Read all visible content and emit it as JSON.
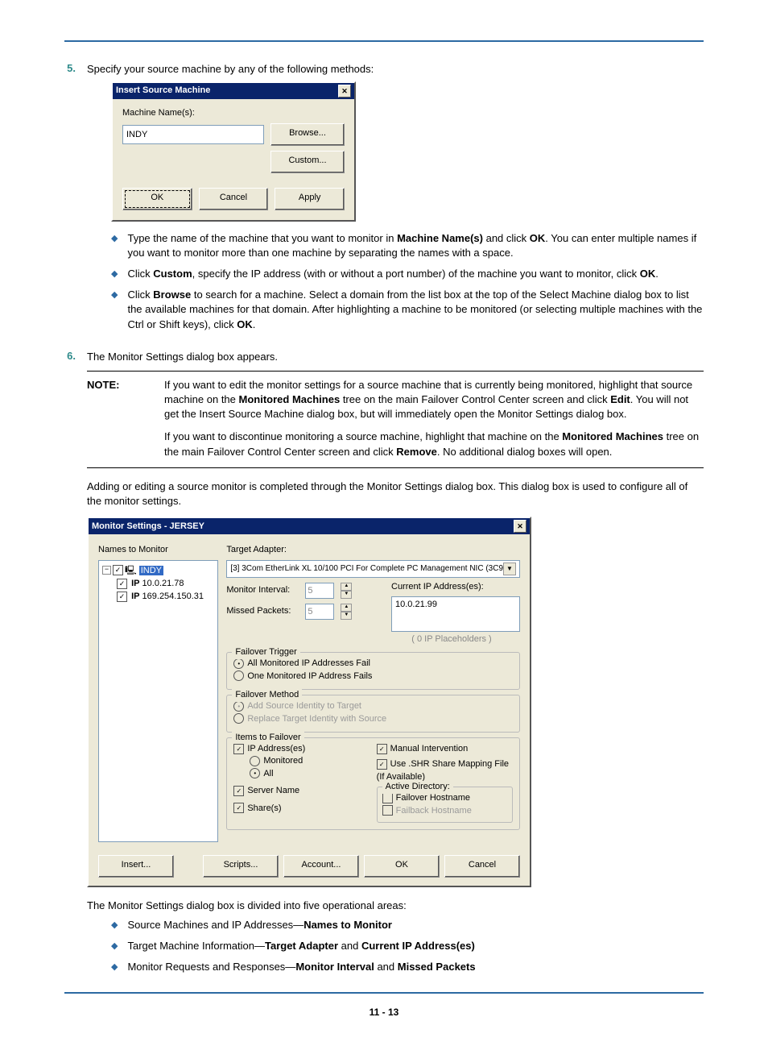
{
  "steps": {
    "5": {
      "num": "5.",
      "text": "Specify your source machine by any of the following methods:"
    },
    "6": {
      "num": "6.",
      "text": "The Monitor Settings dialog box appears."
    }
  },
  "dialog1": {
    "title": "Insert Source Machine",
    "label": "Machine Name(s):",
    "value": "INDY",
    "btn_browse": "Browse...",
    "btn_custom": "Custom...",
    "btn_ok": "OK",
    "btn_cancel": "Cancel",
    "btn_apply": "Apply"
  },
  "bullets1": {
    "a_pre": "Type the name of the machine that you want to monitor in ",
    "a_bold1": "Machine Name(s)",
    "a_mid": " and click ",
    "a_bold2": "OK",
    "a_post": ". You can enter multiple names if you want to monitor more than one machine by separating the names with a space.",
    "b_pre": "Click ",
    "b_bold1": "Custom",
    "b_mid": ", specify the IP address (with or without a port number) of the machine you want to monitor, click ",
    "b_bold2": "OK",
    "b_post": ".",
    "c_pre": "Click ",
    "c_bold1": "Browse",
    "c_mid": " to search for a machine. Select a domain from the list box at the top of the Select Machine dialog box to list the available machines for that domain.  After highlighting a machine to be monitored (or selecting multiple machines with the Ctrl or Shift keys), click ",
    "c_bold2": "OK",
    "c_post": "."
  },
  "note": {
    "label": "NOTE:",
    "p1_pre": "If you want to edit the monitor settings for a source machine that is currently being monitored, highlight that source machine on the ",
    "p1_bold1": "Monitored Machines",
    "p1_mid": " tree on the main Failover Control Center screen and click ",
    "p1_bold2": "Edit",
    "p1_post": ". You will not get the Insert Source Machine dialog box, but will immediately open the Monitor Settings dialog box.",
    "p2_pre": "If you want to discontinue monitoring a source machine, highlight that machine on the ",
    "p2_bold1": "Monitored Machines",
    "p2_mid": " tree on the main Failover Control Center screen and click ",
    "p2_bold2": "Remove",
    "p2_post": ". No additional dialog boxes will open."
  },
  "para_after_note": "Adding or editing a source monitor is completed through the Monitor Settings dialog box. This dialog box is used to configure all of the monitor settings.",
  "dialog2": {
    "title": "Monitor Settings - JERSEY",
    "names_label": "Names to Monitor",
    "tree_root": "INDY",
    "tree_ip1": "10.0.21.78",
    "tree_ip2": "169.254.150.31",
    "target_label": "Target Adapter:",
    "target_value": "[3] 3Com EtherLink XL 10/100 PCI For Complete PC Management NIC (3C9",
    "monitor_interval": "Monitor Interval:",
    "monitor_interval_val": "5",
    "missed_packets": "Missed Packets:",
    "missed_packets_val": "5",
    "current_ip_label": "Current IP Address(es):",
    "current_ip_val": "10.0.21.99",
    "placeholder_btn": "( 0 IP Placeholders )",
    "trigger_title": "Failover Trigger",
    "trigger_opt1": "All Monitored IP Addresses Fail",
    "trigger_opt2": "One Monitored IP Address Fails",
    "method_title": "Failover Method",
    "method_opt1": "Add Source Identity to Target",
    "method_opt2": "Replace Target Identity with Source",
    "items_title": "Items to Failover",
    "item_ip": "IP Address(es)",
    "item_monitored": "Monitored",
    "item_all": "All",
    "item_server": "Server Name",
    "item_shares": "Share(s)",
    "item_manual": "Manual Intervention",
    "item_shr": "Use .SHR Share Mapping File (If Available)",
    "ad_title": "Active Directory:",
    "ad_failover": "Failover Hostname",
    "ad_failback": "Failback Hostname",
    "btn_insert": "Insert...",
    "btn_scripts": "Scripts...",
    "btn_account": "Account...",
    "btn_ok": "OK",
    "btn_cancel": "Cancel"
  },
  "para_after_dialog2": "The Monitor Settings dialog box is divided into five operational areas:",
  "bullets2": {
    "a_pre": "Source Machines and IP Addresses—",
    "a_bold": "Names to Monitor",
    "b_pre": "Target Machine Information—",
    "b_bold1": "Target Adapter",
    "b_mid": " and ",
    "b_bold2": "Current IP Address(es)",
    "c_pre": "Monitor Requests and Responses—",
    "c_bold1": "Monitor Interval",
    "c_mid": " and ",
    "c_bold2": "Missed Packets"
  },
  "page_num": "11 - 13"
}
